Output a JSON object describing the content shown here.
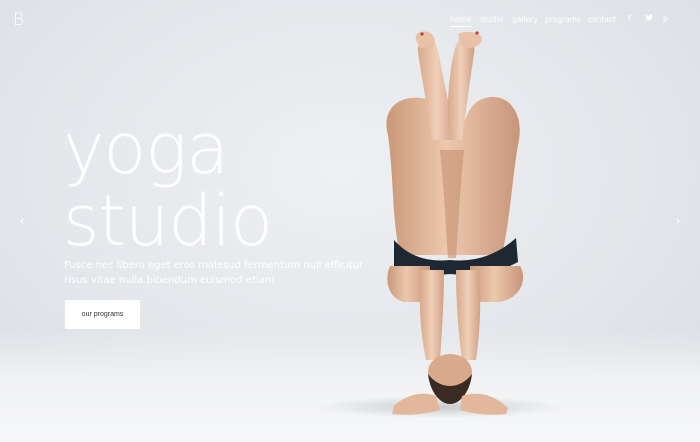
{
  "header": {
    "logo": "B",
    "nav": [
      {
        "label": "home",
        "active": true
      },
      {
        "label": "studio",
        "active": false
      },
      {
        "label": "gallery",
        "active": false
      },
      {
        "label": "programs",
        "active": false
      },
      {
        "label": "contact",
        "active": false
      }
    ],
    "social": [
      {
        "icon": "facebook-icon",
        "glyph": "f"
      },
      {
        "icon": "twitter-icon",
        "glyph": "🐦"
      },
      {
        "icon": "pinterest-icon",
        "glyph": "p"
      }
    ]
  },
  "hero": {
    "title_line1": "yoga",
    "title_line2": "studio",
    "description": "Fusce nec libero eget eros malesud fermentum null efficitur risus vitae nulla bibendum euismod etiam",
    "cta_label": "our programs",
    "prev_glyph": "‹",
    "next_glyph": "›"
  },
  "colors": {
    "background": "#e3e6ea",
    "text": "#ffffff",
    "skin": "#e2b79a",
    "garment": "#1f2733"
  }
}
